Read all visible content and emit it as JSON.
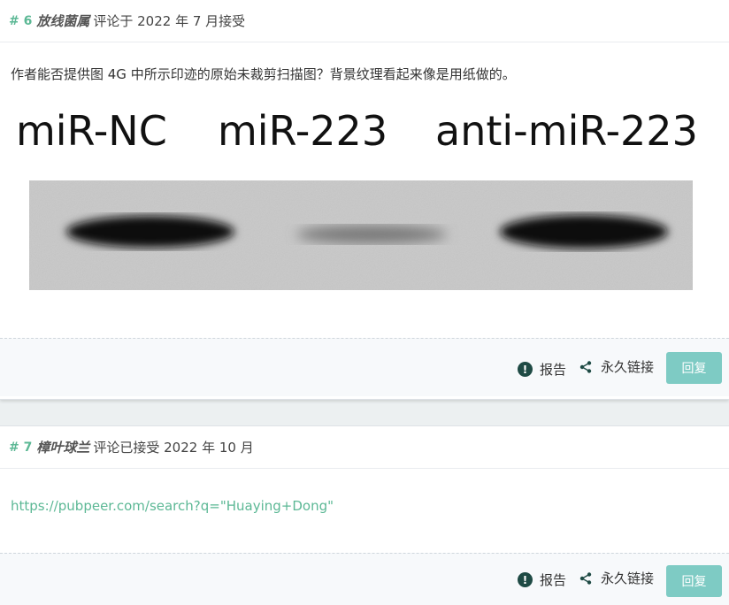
{
  "comments": [
    {
      "num": "# 6",
      "author": "放线菌属",
      "meta": "评论于 2022 年 7 月接受",
      "text": "作者能否提供图 4G 中所示印迹的原始未裁剪扫描图？背景纹理看起来像是用纸做的。",
      "figure": {
        "labels": [
          "miR-NC",
          "miR-223",
          "anti-miR-223"
        ]
      },
      "actions": {
        "report": "报告",
        "permalink": "永久链接",
        "reply": "回复"
      }
    },
    {
      "num": "# 7",
      "author": "樟叶球兰",
      "meta": "评论已接受 2022 年 10 月",
      "link": "https://pubpeer.com/search?q=\"Huaying+Dong\"",
      "actions": {
        "report": "报告",
        "permalink": "永久链接",
        "reply": "回复"
      }
    }
  ],
  "colors": {
    "accent": "#5cb895",
    "reply_bg": "#7ecbc4"
  },
  "icons": {
    "report": "exclamation-circle-icon",
    "permalink": "share-icon"
  }
}
